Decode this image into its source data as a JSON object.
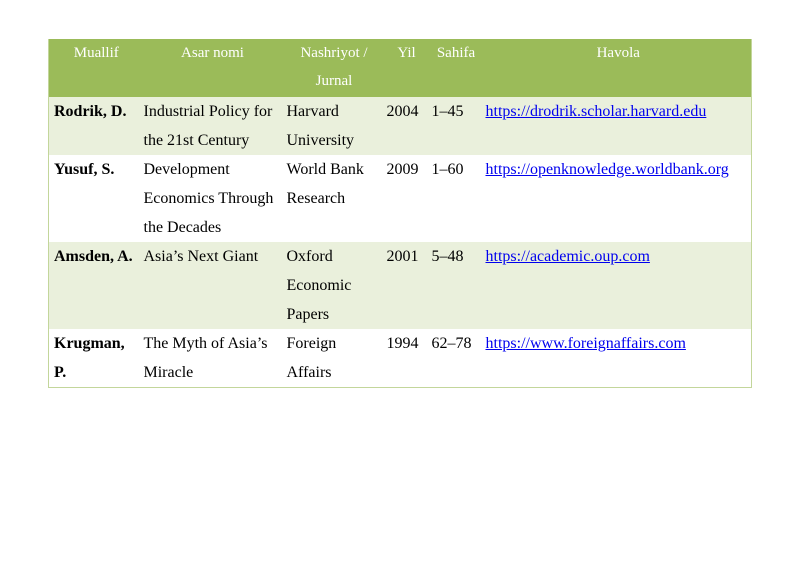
{
  "table": {
    "headers": {
      "author": "Muallif",
      "title": "Asar nomi",
      "publisher": "Nashriyot / Jurnal",
      "year": "Yil",
      "pages": "Sahifa",
      "link": "Havola"
    },
    "rows": [
      {
        "author": "Rodrik, D.",
        "title": "Industrial Policy for the 21st Century",
        "publisher": "Harvard University",
        "year": "2004",
        "pages": "1–45",
        "link": "https://drodrik.scholar.harvard.edu"
      },
      {
        "author": "Yusuf, S.",
        "title": "Development Economics Through the Decades",
        "publisher": "World Bank Research",
        "year": "2009",
        "pages": "1–60",
        "link": "https://openknowledge.worldbank.org"
      },
      {
        "author": "Amsden, A.",
        "title": "Asia’s Next Giant",
        "publisher": "Oxford Economic Papers",
        "year": "2001",
        "pages": "5–48",
        "link": "https://academic.oup.com"
      },
      {
        "author": "Krugman, P.",
        "title": "The Myth of Asia’s Miracle",
        "publisher": "Foreign Affairs",
        "year": "1994",
        "pages": "62–78",
        "link": "https://www.foreignaffairs.com"
      }
    ]
  },
  "colors": {
    "header_bg": "#9bbb59",
    "band_bg": "#eaf0dc",
    "link": "#0000ee"
  }
}
